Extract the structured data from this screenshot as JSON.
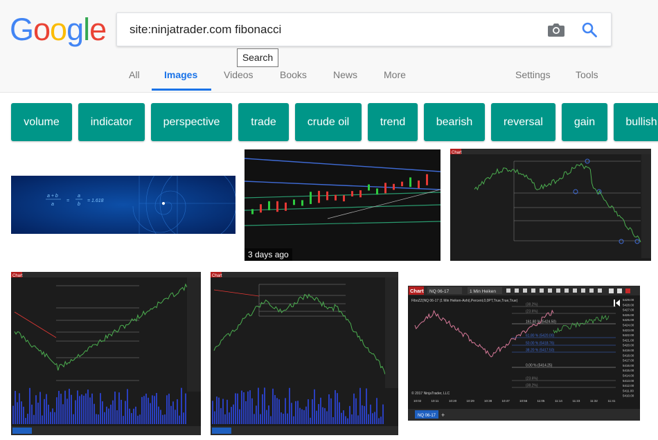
{
  "logo": {
    "text": "Google",
    "letters": [
      "G",
      "o",
      "o",
      "g",
      "l",
      "e"
    ],
    "colors": [
      "#4285F4",
      "#EA4335",
      "#FBBC05",
      "#4285F4",
      "#34A853",
      "#EA4335"
    ]
  },
  "search": {
    "query": "site:ninjatrader.com fibonacci",
    "tooltip": "Search"
  },
  "icons": {
    "camera": "camera-icon",
    "search": "search-icon"
  },
  "tabs": {
    "all": "All",
    "images": "Images",
    "videos": "Videos",
    "books": "Books",
    "news": "News",
    "more": "More",
    "settings": "Settings",
    "tools": "Tools"
  },
  "chips": [
    "volume",
    "indicator",
    "perspective",
    "trade",
    "crude oil",
    "trend",
    "bearish",
    "reversal",
    "gain",
    "bullish"
  ],
  "colors": {
    "accent": "#1a73e8",
    "chip_bg": "#009688"
  },
  "results": {
    "thumb1_formula": {
      "lhs_num": "a + b",
      "lhs_den": "a",
      "rhs_num": "a",
      "rhs_den": "b",
      "value": "= 1.618"
    },
    "thumb2_badge": "3 days ago",
    "chart_tab": "Chart",
    "thumb6": {
      "instrument": "NQ 06-17",
      "period": "1 Min Heiken",
      "title_line": "FiboZZ(NQ 06-17 (1 Min Heiken-Ashi),Percent,0,0PT,True,True,True)",
      "copyright": "© 2017 NinjaTrader, LLC",
      "fib_labels": [
        "(38.2%)",
        "(23.6%)",
        "161.80 % (5424.50)",
        "61.80 % (5420.00)",
        "50.00 % (5418.76)",
        "38.20 % (5417.50)",
        "0.00 % (5414.25)",
        "(23.6%)",
        "(38.2%)"
      ],
      "price_axis": [
        "5429.00",
        "5428.00",
        "5427.00",
        "5426.00",
        "5425.00",
        "5424.00",
        "5423.00",
        "5422.00",
        "5421.00",
        "5420.00",
        "5419.00",
        "5418.00",
        "5417.00",
        "5416.00",
        "5415.00",
        "5414.00",
        "5413.00",
        "5412.00",
        "5411.00",
        "5410.00"
      ],
      "time_axis": [
        "10:02",
        "10:11",
        "10:20",
        "10:29",
        "10:38",
        "10:47",
        "10:56",
        "11:05",
        "11:14",
        "11:23",
        "11:32",
        "11:41"
      ]
    }
  }
}
